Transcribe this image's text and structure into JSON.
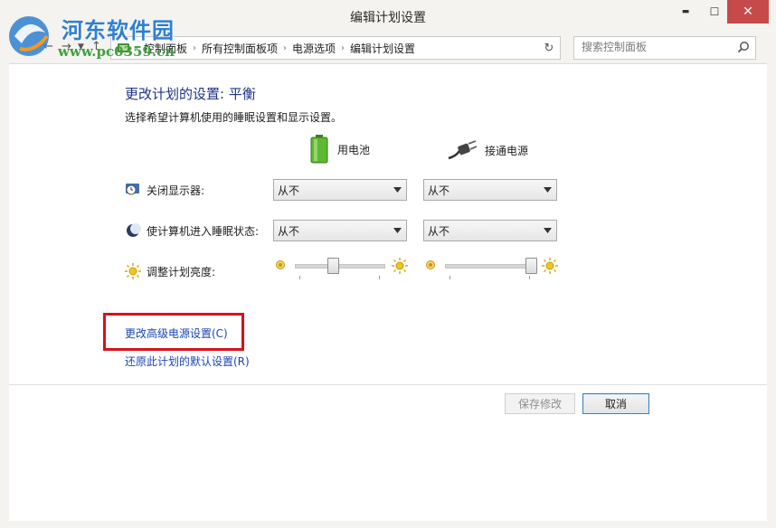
{
  "window": {
    "title": "编辑计划设置",
    "minimize_glyph": "▬",
    "maximize_glyph": "☐",
    "close_glyph": "✕"
  },
  "watermark": {
    "name": "河东软件园",
    "url": "www.pc0359.cn"
  },
  "breadcrumb": {
    "items": [
      "控制面板",
      "所有控制面板项",
      "电源选项",
      "编辑计划设置"
    ],
    "separator": "›"
  },
  "search": {
    "placeholder": "搜索控制面板"
  },
  "main": {
    "heading": "更改计划的设置: 平衡",
    "subtitle": "选择希望计算机使用的睡眠设置和显示设置。",
    "columns": [
      {
        "label": "用电池",
        "icon": "battery-icon"
      },
      {
        "label": "接通电源",
        "icon": "power-plug-icon"
      }
    ],
    "settings": [
      {
        "label": "关闭显示器:",
        "icon": "display-timer-icon",
        "battery": "从不",
        "plugged": "从不"
      },
      {
        "label": "使计算机进入睡眠状态:",
        "icon": "sleep-moon-icon",
        "battery": "从不",
        "plugged": "从不"
      },
      {
        "label": "调整计划亮度:",
        "icon": "brightness-sun-icon",
        "battery_level": 0.4,
        "plugged_level": 1.0
      }
    ],
    "links": {
      "advanced": "更改高级电源设置(C)",
      "restore": "还原此计划的默认设置(R)"
    },
    "buttons": {
      "save": "保存修改",
      "cancel": "取消"
    }
  },
  "colors": {
    "heading": "#1e3287",
    "link": "#1a45b5",
    "highlight_box": "#d6121c",
    "close_button": "#c74a4a"
  }
}
